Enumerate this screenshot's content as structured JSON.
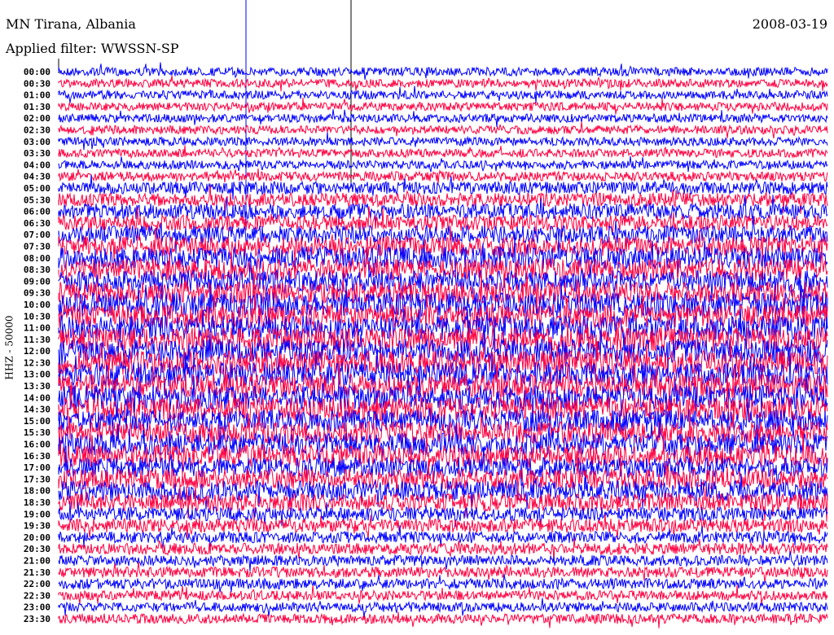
{
  "header": {
    "station": "MN Tirana, Albania",
    "filter": "Applied filter: WWSSN-SP",
    "date": "2008-03-19"
  },
  "chart_data": {
    "type": "line",
    "title": "MN Tirana, Albania",
    "ylabel": "HHZ - 50000",
    "colors": [
      "#0000ff",
      "#ff0040"
    ],
    "rows": [
      "00:00",
      "00:30",
      "01:00",
      "01:30",
      "02:00",
      "02:30",
      "03:00",
      "03:30",
      "04:00",
      "04:30",
      "05:00",
      "05:30",
      "06:00",
      "06:30",
      "07:00",
      "07:30",
      "08:00",
      "08:30",
      "09:00",
      "09:30",
      "10:00",
      "10:30",
      "11:00",
      "11:30",
      "12:00",
      "12:30",
      "13:00",
      "13:30",
      "14:00",
      "14:30",
      "15:00",
      "15:30",
      "16:00",
      "16:30",
      "17:00",
      "17:30",
      "18:00",
      "18:30",
      "19:00",
      "19:30",
      "20:00",
      "20:30",
      "21:00",
      "21:30",
      "22:00",
      "22:30",
      "23:00",
      "23:30"
    ],
    "noise_level": [
      0.25,
      0.25,
      0.25,
      0.25,
      0.25,
      0.25,
      0.25,
      0.25,
      0.25,
      0.3,
      0.45,
      0.5,
      0.6,
      0.6,
      0.7,
      0.8,
      0.9,
      0.9,
      0.9,
      0.9,
      1.0,
      1.0,
      1.0,
      1.0,
      1.0,
      1.0,
      1.0,
      1.0,
      1.0,
      1.0,
      0.9,
      0.9,
      0.9,
      0.9,
      0.8,
      0.8,
      0.8,
      0.7,
      0.5,
      0.5,
      0.4,
      0.4,
      0.35,
      0.35,
      0.35,
      0.3,
      0.3,
      0.3
    ],
    "x_range_minutes": [
      0,
      30
    ]
  }
}
